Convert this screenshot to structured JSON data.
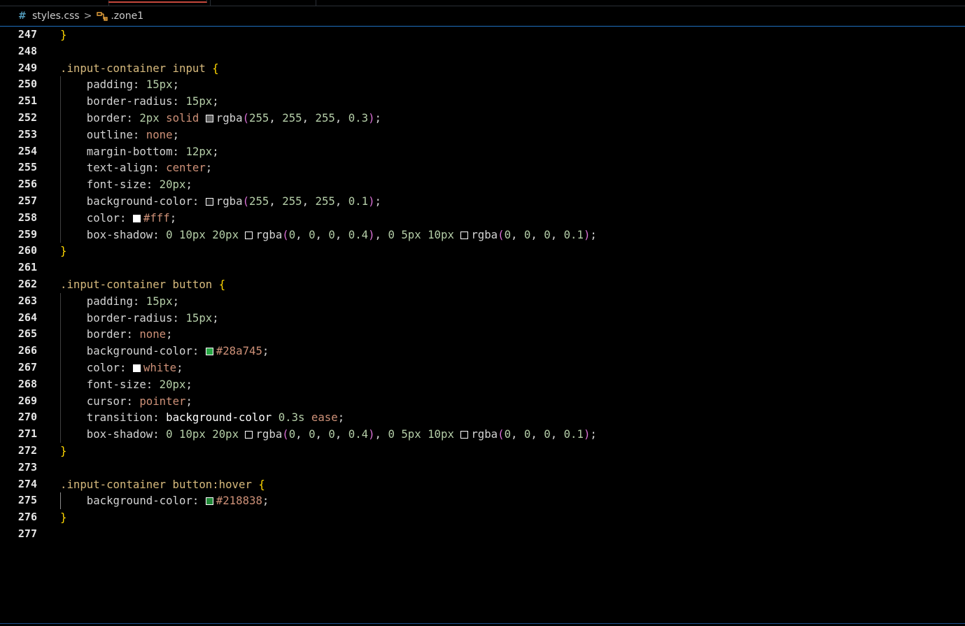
{
  "breadcrumb": {
    "file_icon": "css-hash-icon",
    "file": "styles.css",
    "separator": ">",
    "symbol_icon": "css-selector-icon",
    "symbol": ".zone1"
  },
  "colors": {
    "background": "#000000",
    "selector": "#d7ba7d",
    "brace": "#ffd700",
    "number": "#b5cea8",
    "keyword": "#ce9178",
    "paren": "#da70d6",
    "line_number": "#e6e6e6"
  },
  "lines": [
    {
      "n": "247",
      "guide": false,
      "tokens": [
        {
          "t": "}",
          "c": "brace"
        }
      ]
    },
    {
      "n": "248",
      "guide": false,
      "tokens": []
    },
    {
      "n": "249",
      "guide": false,
      "tokens": [
        {
          "t": ".input-container input ",
          "c": "sel"
        },
        {
          "t": "{",
          "c": "brace"
        }
      ]
    },
    {
      "n": "250",
      "guide": true,
      "tokens": [
        {
          "t": "    padding: ",
          "c": "propn"
        },
        {
          "t": "15px",
          "c": "num"
        },
        {
          "t": ";",
          "c": "punc"
        }
      ]
    },
    {
      "n": "251",
      "guide": true,
      "tokens": [
        {
          "t": "    border-radius: ",
          "c": "propn"
        },
        {
          "t": "15px",
          "c": "num"
        },
        {
          "t": ";",
          "c": "punc"
        }
      ]
    },
    {
      "n": "252",
      "guide": true,
      "tokens": [
        {
          "t": "    border: ",
          "c": "propn"
        },
        {
          "t": "2px ",
          "c": "num"
        },
        {
          "t": "solid ",
          "c": "kw"
        },
        {
          "sw": "#5e5e5e"
        },
        {
          "t": "rgba",
          "c": "propn"
        },
        {
          "t": "(",
          "c": "paren"
        },
        {
          "t": "255",
          "c": "num"
        },
        {
          "t": ", ",
          "c": "punc"
        },
        {
          "t": "255",
          "c": "num"
        },
        {
          "t": ", ",
          "c": "punc"
        },
        {
          "t": "255",
          "c": "num"
        },
        {
          "t": ", ",
          "c": "punc"
        },
        {
          "t": "0.3",
          "c": "num"
        },
        {
          "t": ")",
          "c": "paren"
        },
        {
          "t": ";",
          "c": "punc"
        }
      ]
    },
    {
      "n": "253",
      "guide": true,
      "tokens": [
        {
          "t": "    outline: ",
          "c": "propn"
        },
        {
          "t": "none",
          "c": "kw"
        },
        {
          "t": ";",
          "c": "punc"
        }
      ]
    },
    {
      "n": "254",
      "guide": true,
      "tokens": [
        {
          "t": "    margin-bottom: ",
          "c": "propn"
        },
        {
          "t": "12px",
          "c": "num"
        },
        {
          "t": ";",
          "c": "punc"
        }
      ]
    },
    {
      "n": "255",
      "guide": true,
      "tokens": [
        {
          "t": "    text-align: ",
          "c": "propn"
        },
        {
          "t": "center",
          "c": "kw"
        },
        {
          "t": ";",
          "c": "punc"
        }
      ]
    },
    {
      "n": "256",
      "guide": true,
      "tokens": [
        {
          "t": "    font-size: ",
          "c": "propn"
        },
        {
          "t": "20px",
          "c": "num"
        },
        {
          "t": ";",
          "c": "punc"
        }
      ]
    },
    {
      "n": "257",
      "guide": true,
      "tokens": [
        {
          "t": "    background-color: ",
          "c": "propn"
        },
        {
          "sw": "#1a1a1a"
        },
        {
          "t": "rgba",
          "c": "propn"
        },
        {
          "t": "(",
          "c": "paren"
        },
        {
          "t": "255",
          "c": "num"
        },
        {
          "t": ", ",
          "c": "punc"
        },
        {
          "t": "255",
          "c": "num"
        },
        {
          "t": ", ",
          "c": "punc"
        },
        {
          "t": "255",
          "c": "num"
        },
        {
          "t": ", ",
          "c": "punc"
        },
        {
          "t": "0.1",
          "c": "num"
        },
        {
          "t": ")",
          "c": "paren"
        },
        {
          "t": ";",
          "c": "punc"
        }
      ]
    },
    {
      "n": "258",
      "guide": true,
      "tokens": [
        {
          "t": "    color: ",
          "c": "propn"
        },
        {
          "sw": "#ffffff"
        },
        {
          "t": "#fff",
          "c": "kw"
        },
        {
          "t": ";",
          "c": "punc"
        }
      ]
    },
    {
      "n": "259",
      "guide": true,
      "tokens": [
        {
          "t": "    box-shadow: ",
          "c": "propn"
        },
        {
          "t": "0 ",
          "c": "num"
        },
        {
          "t": "10px ",
          "c": "num"
        },
        {
          "t": "20px ",
          "c": "num"
        },
        {
          "sw": "#000000"
        },
        {
          "t": "rgba",
          "c": "propn"
        },
        {
          "t": "(",
          "c": "paren"
        },
        {
          "t": "0",
          "c": "num"
        },
        {
          "t": ", ",
          "c": "punc"
        },
        {
          "t": "0",
          "c": "num"
        },
        {
          "t": ", ",
          "c": "punc"
        },
        {
          "t": "0",
          "c": "num"
        },
        {
          "t": ", ",
          "c": "punc"
        },
        {
          "t": "0.4",
          "c": "num"
        },
        {
          "t": ")",
          "c": "paren"
        },
        {
          "t": ", ",
          "c": "punc"
        },
        {
          "t": "0 ",
          "c": "num"
        },
        {
          "t": "5px ",
          "c": "num"
        },
        {
          "t": "10px ",
          "c": "num"
        },
        {
          "sw": "#000000"
        },
        {
          "t": "rgba",
          "c": "propn"
        },
        {
          "t": "(",
          "c": "paren"
        },
        {
          "t": "0",
          "c": "num"
        },
        {
          "t": ", ",
          "c": "punc"
        },
        {
          "t": "0",
          "c": "num"
        },
        {
          "t": ", ",
          "c": "punc"
        },
        {
          "t": "0",
          "c": "num"
        },
        {
          "t": ", ",
          "c": "punc"
        },
        {
          "t": "0.1",
          "c": "num"
        },
        {
          "t": ")",
          "c": "paren"
        },
        {
          "t": ";",
          "c": "punc"
        }
      ]
    },
    {
      "n": "260",
      "guide": false,
      "tokens": [
        {
          "t": "}",
          "c": "brace"
        }
      ]
    },
    {
      "n": "261",
      "guide": false,
      "tokens": []
    },
    {
      "n": "262",
      "guide": false,
      "tokens": [
        {
          "t": ".input-container button ",
          "c": "sel"
        },
        {
          "t": "{",
          "c": "brace"
        }
      ]
    },
    {
      "n": "263",
      "guide": true,
      "tokens": [
        {
          "t": "    padding: ",
          "c": "propn"
        },
        {
          "t": "15px",
          "c": "num"
        },
        {
          "t": ";",
          "c": "punc"
        }
      ]
    },
    {
      "n": "264",
      "guide": true,
      "tokens": [
        {
          "t": "    border-radius: ",
          "c": "propn"
        },
        {
          "t": "15px",
          "c": "num"
        },
        {
          "t": ";",
          "c": "punc"
        }
      ]
    },
    {
      "n": "265",
      "guide": true,
      "tokens": [
        {
          "t": "    border: ",
          "c": "propn"
        },
        {
          "t": "none",
          "c": "kw"
        },
        {
          "t": ";",
          "c": "punc"
        }
      ]
    },
    {
      "n": "266",
      "guide": true,
      "tokens": [
        {
          "t": "    background-color: ",
          "c": "propn"
        },
        {
          "sw": "#28a745"
        },
        {
          "t": "#28a745",
          "c": "kw"
        },
        {
          "t": ";",
          "c": "punc"
        }
      ]
    },
    {
      "n": "267",
      "guide": true,
      "tokens": [
        {
          "t": "    color: ",
          "c": "propn"
        },
        {
          "sw": "#ffffff"
        },
        {
          "t": "white",
          "c": "kw"
        },
        {
          "t": ";",
          "c": "punc"
        }
      ]
    },
    {
      "n": "268",
      "guide": true,
      "tokens": [
        {
          "t": "    font-size: ",
          "c": "propn"
        },
        {
          "t": "20px",
          "c": "num"
        },
        {
          "t": ";",
          "c": "punc"
        }
      ]
    },
    {
      "n": "269",
      "guide": true,
      "tokens": [
        {
          "t": "    cursor: ",
          "c": "propn"
        },
        {
          "t": "pointer",
          "c": "kw"
        },
        {
          "t": ";",
          "c": "punc"
        }
      ]
    },
    {
      "n": "270",
      "guide": true,
      "tokens": [
        {
          "t": "    transition: ",
          "c": "propn"
        },
        {
          "t": "background-color ",
          "c": "white"
        },
        {
          "t": "0.3s ",
          "c": "num"
        },
        {
          "t": "ease",
          "c": "kw"
        },
        {
          "t": ";",
          "c": "punc"
        }
      ]
    },
    {
      "n": "271",
      "guide": true,
      "tokens": [
        {
          "t": "    box-shadow: ",
          "c": "propn"
        },
        {
          "t": "0 ",
          "c": "num"
        },
        {
          "t": "10px ",
          "c": "num"
        },
        {
          "t": "20px ",
          "c": "num"
        },
        {
          "sw": "#000000"
        },
        {
          "t": "rgba",
          "c": "propn"
        },
        {
          "t": "(",
          "c": "paren"
        },
        {
          "t": "0",
          "c": "num"
        },
        {
          "t": ", ",
          "c": "punc"
        },
        {
          "t": "0",
          "c": "num"
        },
        {
          "t": ", ",
          "c": "punc"
        },
        {
          "t": "0",
          "c": "num"
        },
        {
          "t": ", ",
          "c": "punc"
        },
        {
          "t": "0.4",
          "c": "num"
        },
        {
          "t": ")",
          "c": "paren"
        },
        {
          "t": ", ",
          "c": "punc"
        },
        {
          "t": "0 ",
          "c": "num"
        },
        {
          "t": "5px ",
          "c": "num"
        },
        {
          "t": "10px ",
          "c": "num"
        },
        {
          "sw": "#000000"
        },
        {
          "t": "rgba",
          "c": "propn"
        },
        {
          "t": "(",
          "c": "paren"
        },
        {
          "t": "0",
          "c": "num"
        },
        {
          "t": ", ",
          "c": "punc"
        },
        {
          "t": "0",
          "c": "num"
        },
        {
          "t": ", ",
          "c": "punc"
        },
        {
          "t": "0",
          "c": "num"
        },
        {
          "t": ", ",
          "c": "punc"
        },
        {
          "t": "0.1",
          "c": "num"
        },
        {
          "t": ")",
          "c": "paren"
        },
        {
          "t": ";",
          "c": "punc"
        }
      ]
    },
    {
      "n": "272",
      "guide": false,
      "tokens": [
        {
          "t": "}",
          "c": "brace"
        }
      ]
    },
    {
      "n": "273",
      "guide": false,
      "tokens": []
    },
    {
      "n": "274",
      "guide": false,
      "tokens": [
        {
          "t": ".input-container button:hover ",
          "c": "sel"
        },
        {
          "t": "{",
          "c": "brace"
        }
      ]
    },
    {
      "n": "275",
      "guide": "active",
      "tokens": [
        {
          "t": "    background-color: ",
          "c": "propn"
        },
        {
          "sw": "#218838"
        },
        {
          "t": "#218838",
          "c": "kw"
        },
        {
          "t": ";",
          "c": "punc"
        }
      ]
    },
    {
      "n": "276",
      "guide": false,
      "tokens": [
        {
          "t": "}",
          "c": "brace"
        }
      ]
    },
    {
      "n": "277",
      "guide": false,
      "tokens": []
    }
  ]
}
